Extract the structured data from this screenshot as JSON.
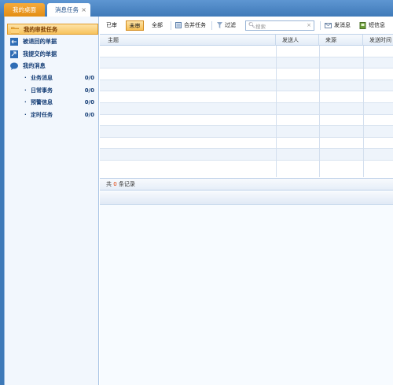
{
  "tabs": {
    "desktop": "我的桌面",
    "messages": "消息任务",
    "close": "×"
  },
  "sidebar": {
    "items": [
      {
        "label": "我的审批任务",
        "icon": "folder-icon",
        "active": true
      },
      {
        "label": "被退回的单据",
        "icon": "return-doc-icon"
      },
      {
        "label": "我提交的单据",
        "icon": "submit-doc-icon"
      },
      {
        "label": "我的消息",
        "icon": "chat-bubble-icon"
      }
    ],
    "sub_items": [
      {
        "label": "业务消息",
        "count": "0/0"
      },
      {
        "label": "日常事务",
        "count": "0/0"
      },
      {
        "label": "预警信息",
        "count": "0/0"
      },
      {
        "label": "定时任务",
        "count": "0/0"
      }
    ],
    "bullet": "·"
  },
  "toolbar": {
    "approved": "已审",
    "unapproved": "未审",
    "all": "全部",
    "merge": "合并任务",
    "filter": "过滤",
    "search_placeholder": "搜索",
    "send_message": "发消息",
    "sms": "短信息"
  },
  "grid": {
    "columns": [
      "主题",
      "发送人",
      "来源",
      "发送时间"
    ],
    "row_count": 10
  },
  "footer": {
    "prefix": "共",
    "count": "0",
    "suffix": "条记录"
  },
  "colors": {
    "accent": "#f6bf55",
    "frame_blue": "#3f7ab8",
    "count_red": "#e03c00"
  }
}
